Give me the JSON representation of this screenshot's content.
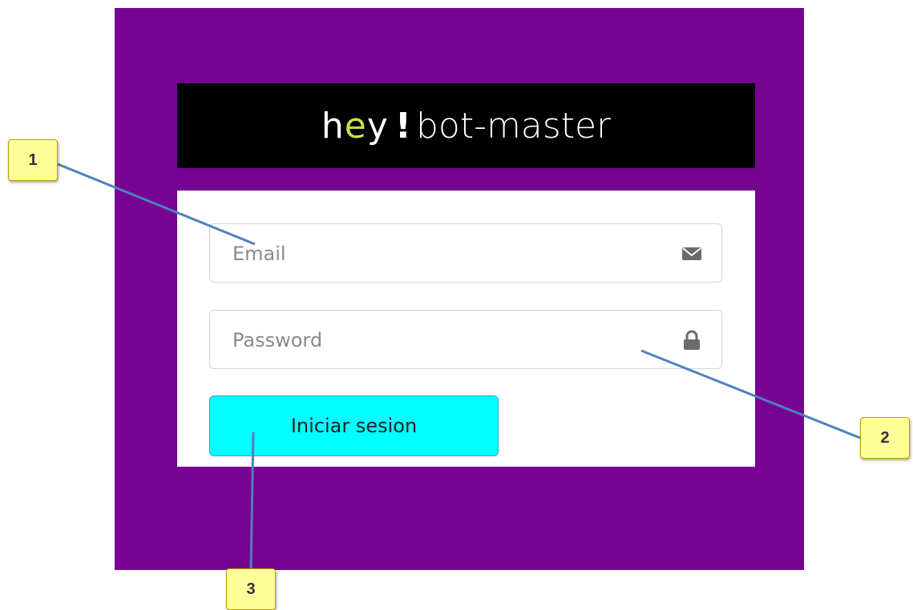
{
  "logo": {
    "h": "h",
    "e": "e",
    "y": "y",
    "bang": "!",
    "rest": "bot-master"
  },
  "form": {
    "email_placeholder": "Email",
    "password_placeholder": "Password",
    "submit_label": "Iniciar sesion"
  },
  "icons": {
    "email": "envelope-icon",
    "password": "lock-icon"
  },
  "callouts": [
    "1",
    "2",
    "3"
  ],
  "colors": {
    "panel": "#770393",
    "logo_bg": "#000000",
    "logo_accent": "#c6e14c",
    "button": "#00ffff",
    "callout_bg": "#ffff99",
    "callout_line": "#4f81bd"
  }
}
